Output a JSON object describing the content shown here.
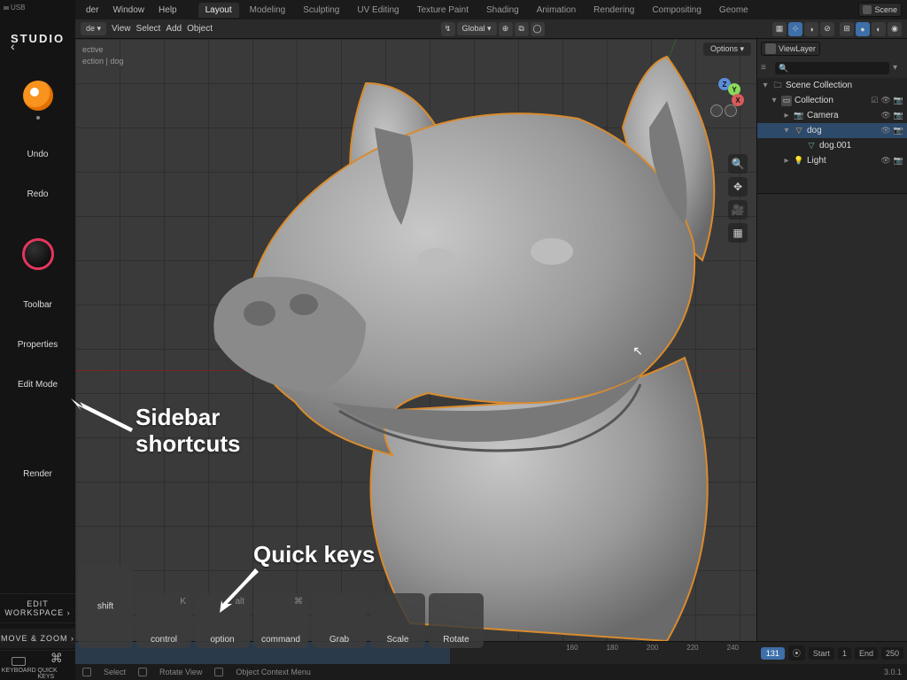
{
  "studio": {
    "usb": "USB",
    "title": "STUDIO",
    "buttons": [
      "Undo",
      "Redo",
      "Toolbar",
      "Properties",
      "Edit Mode",
      "Render"
    ],
    "edit_workspace": "EDIT WORKSPACE ›",
    "move_zoom": "MOVE & ZOOM ›",
    "bottom": {
      "keyboard": "KEYBOARD",
      "quickkeys": "QUICK KEYS"
    }
  },
  "menubar": {
    "menus": [
      "der",
      "Window",
      "Help"
    ],
    "tabs": [
      "Layout",
      "Modeling",
      "Sculpting",
      "UV Editing",
      "Texture Paint",
      "Shading",
      "Animation",
      "Rendering",
      "Compositing",
      "Geome"
    ],
    "active_tab": "Layout",
    "scene_label": "Scene",
    "viewlayer_label": "ViewLayer"
  },
  "toolbar2": {
    "mode": "de ▾",
    "view": "View",
    "select": "Select",
    "add": "Add",
    "object": "Object",
    "orient": "Global"
  },
  "viewport": {
    "persp": "ective",
    "path": "ection | dog",
    "options": "Options ▾",
    "gizmo": {
      "x": "X",
      "y": "Y",
      "z": "Z"
    }
  },
  "timeline": {
    "ticks": [
      "160",
      "180",
      "200",
      "220",
      "240"
    ],
    "current": "131",
    "start_label": "Start",
    "start": "1",
    "end_label": "End",
    "end": "250"
  },
  "statusbar": {
    "select": "Select",
    "rotate": "Rotate View",
    "context": "Object Context Menu"
  },
  "outliner": {
    "scene_collection": "Scene Collection",
    "collection": "Collection",
    "items": [
      {
        "name": "Camera",
        "icon": "cam"
      },
      {
        "name": "dog",
        "icon": "mesh",
        "selected": true
      },
      {
        "name": "dog.001",
        "icon": "mesh-child"
      },
      {
        "name": "Light",
        "icon": "light"
      }
    ]
  },
  "version": "3.0.1",
  "quickkeys": [
    {
      "label": "shift",
      "tall": true
    },
    {
      "label": "control",
      "sym": "K"
    },
    {
      "label": "option",
      "sym": "alt"
    },
    {
      "label": "command",
      "sym": "⌘"
    },
    {
      "label": "Grab"
    },
    {
      "label": "Scale"
    },
    {
      "label": "Rotate"
    }
  ],
  "annotations": {
    "sidebar": "Sidebar\nshortcuts",
    "quick": "Quick keys"
  },
  "colors": {
    "accent": "#3d6fa8",
    "danger": "#e4365e",
    "blender": "#f7931e"
  }
}
